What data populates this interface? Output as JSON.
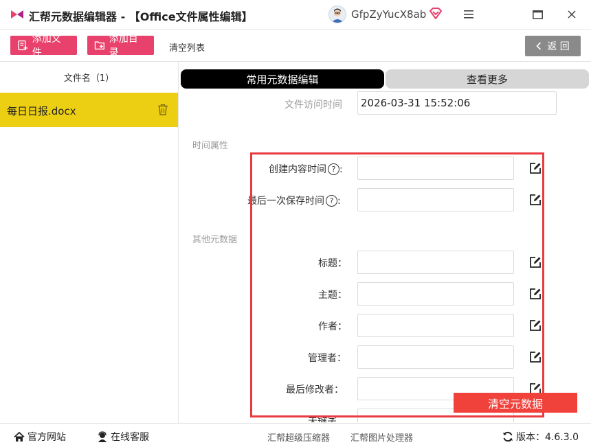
{
  "app": {
    "title": "汇帮元数据编辑器 - 【Office文件属性编辑】",
    "username": "GfpZyYucX8ab",
    "accent": "#e8416b"
  },
  "window_controls": {
    "menu": "≡",
    "maximize": "□",
    "close": "✕"
  },
  "toolbar": {
    "add_file": "添加文件",
    "add_dir": "添加目录",
    "clear_list": "清空列表",
    "back": "返 回"
  },
  "file_list": {
    "header": "文件名（1）",
    "files": [
      {
        "name": "每日日报.docx"
      }
    ],
    "selected_color": "#eccf12"
  },
  "tabs": [
    {
      "label": "常用元数据编辑",
      "active": true
    },
    {
      "label": "查看更多",
      "active": false
    }
  ],
  "form": {
    "access_time_label": "文件访问时间",
    "access_time_value": "2026-03-31 15:52:06",
    "time_section": "时间属性",
    "create_time_label": "创建内容时间",
    "create_time_value": "",
    "save_time_label": "最后一次保存时间",
    "save_time_value": "",
    "other_section": "其他元数据",
    "title_label": "标题：",
    "title_value": "",
    "subject_label": "主题：",
    "subject_value": "",
    "author_label": "作者：",
    "author_value": "",
    "manager_label": "管理者：",
    "manager_value": "",
    "last_modifier_label": "最后修改者：",
    "last_modifier_value": "",
    "keywords_label": "关键字",
    "help_glyph": "?",
    "colon": ":"
  },
  "clear_metadata": "清空元数据",
  "statusbar": {
    "website": "官方网站",
    "support": "在线客服",
    "compressor": "汇帮超级压缩器",
    "image_tool": "汇帮图片处理器",
    "version": "版本：4.6.3.0"
  }
}
